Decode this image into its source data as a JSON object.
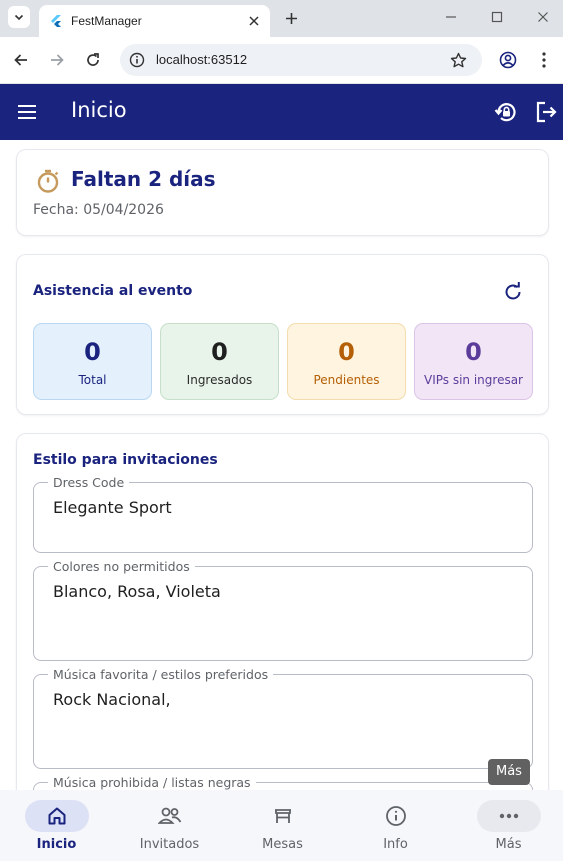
{
  "browser": {
    "tab_title": "FestManager",
    "url": "localhost:63512"
  },
  "appbar": {
    "title": "Inicio"
  },
  "countdown": {
    "heading": "Faltan 2 días",
    "date": "Fecha: 05/04/2026"
  },
  "attendance": {
    "title": "Asistencia al evento",
    "stats": [
      {
        "value": "0",
        "label": "Total",
        "color": "#1a237e"
      },
      {
        "value": "0",
        "label": "Ingresados",
        "color": "#1f1f1f"
      },
      {
        "value": "0",
        "label": "Pendientes",
        "color": "#b45f06"
      },
      {
        "value": "0",
        "label": "VIPs sin ingresar",
        "color": "#5c3c9a"
      }
    ]
  },
  "style_section": {
    "title": "Estilo para invitaciones",
    "fields": [
      {
        "label": "Dress Code",
        "value": "Elegante Sport"
      },
      {
        "label": "Colores no permitidos",
        "value": "Blanco, Rosa, Violeta"
      },
      {
        "label": "Música favorita / estilos preferidos",
        "value": "Rock Nacional,"
      },
      {
        "label": "Música prohibida / listas negras",
        "value": ""
      }
    ]
  },
  "tooltip": "Más",
  "bottom_nav": [
    {
      "label": "Inicio",
      "icon": "home-icon",
      "active": true
    },
    {
      "label": "Invitados",
      "icon": "people-icon"
    },
    {
      "label": "Mesas",
      "icon": "table-icon"
    },
    {
      "label": "Info",
      "icon": "info-icon"
    },
    {
      "label": "Más",
      "icon": "more-icon"
    }
  ],
  "colors": {
    "primary": "#1a237e",
    "surface": "#f6f7fb"
  }
}
